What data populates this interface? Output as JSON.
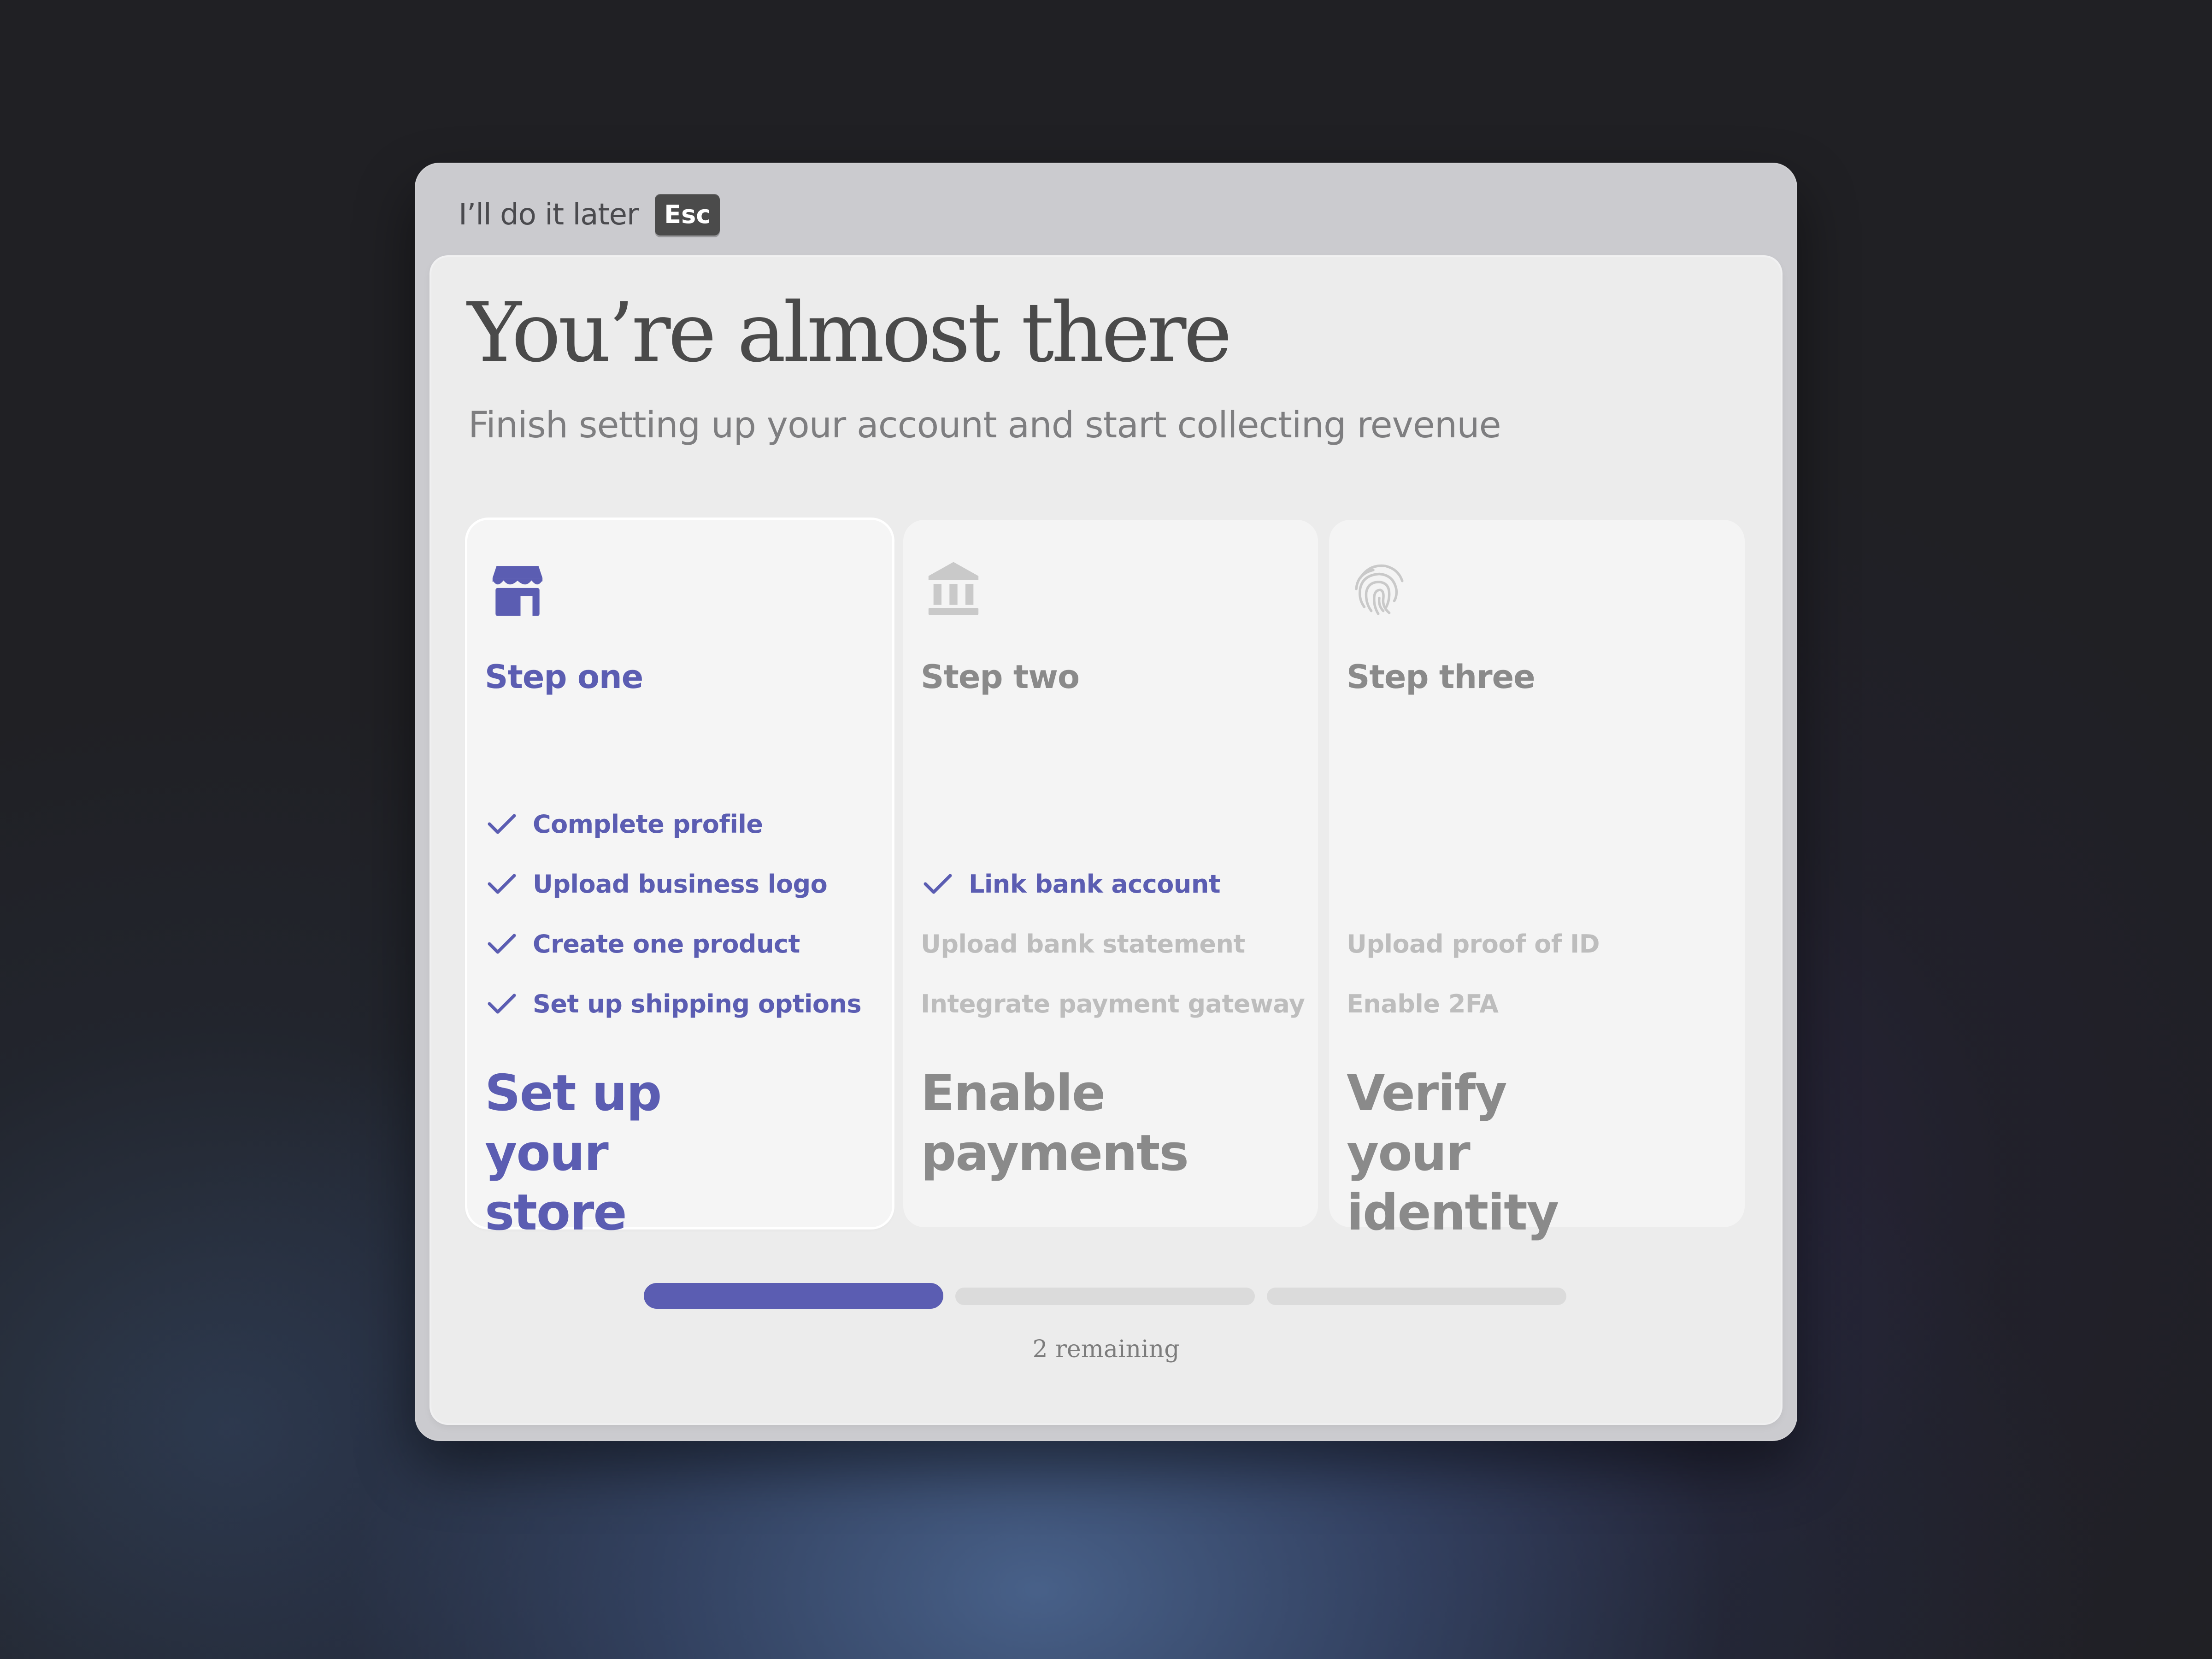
{
  "modal": {
    "dismiss_label": "I’ll do it later",
    "dismiss_key": "Esc",
    "title": "You’re almost there",
    "subtitle": "Finish setting up your account and start collecting revenue"
  },
  "steps": [
    {
      "icon": "store-icon",
      "label": "Step one",
      "heading": "Set up your store",
      "state": "active",
      "tasks": [
        {
          "text": "Complete profile",
          "done": true
        },
        {
          "text": "Upload business logo",
          "done": true
        },
        {
          "text": "Create one product",
          "done": true
        },
        {
          "text": "Set up shipping options",
          "done": true
        }
      ]
    },
    {
      "icon": "bank-icon",
      "label": "Step two",
      "heading": "Enable payments",
      "state": "inactive",
      "tasks": [
        {
          "text": "Link bank account",
          "done": true
        },
        {
          "text": "Upload bank statement",
          "done": false
        },
        {
          "text": "Integrate payment gateway",
          "done": false
        }
      ]
    },
    {
      "icon": "fingerprint-icon",
      "label": "Step three",
      "heading": "Verify your identity",
      "state": "inactive",
      "tasks": [
        {
          "text": "Upload proof of ID",
          "done": false
        },
        {
          "text": "Enable 2FA",
          "done": false
        }
      ]
    }
  ],
  "progress": {
    "completed_steps": 1,
    "total_steps": 3,
    "remaining_label": "2 remaining"
  },
  "colors": {
    "accent": "#5b5db2",
    "muted_text": "#8a8a8a",
    "pending_text": "#bdbdbd",
    "inactive_icon": "#c9c9c9"
  }
}
